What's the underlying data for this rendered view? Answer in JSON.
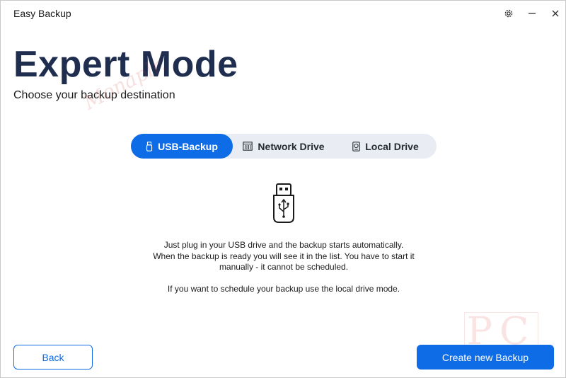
{
  "window": {
    "title": "Easy Backup",
    "controls": {
      "settings_icon": "gear-icon",
      "minimize_icon": "minimize-icon",
      "close_icon": "close-icon"
    }
  },
  "header": {
    "title": "Expert Mode",
    "subtitle": "Choose your backup destination"
  },
  "watermarks": {
    "signature": "Monaplr.",
    "corner": "PC"
  },
  "tabs": [
    {
      "label": "USB-Backup",
      "icon": "usb-icon",
      "selected": true
    },
    {
      "label": "Network Drive",
      "icon": "network-drive-icon",
      "selected": false
    },
    {
      "label": "Local Drive",
      "icon": "local-drive-icon",
      "selected": false
    }
  ],
  "usb_panel": {
    "illustration_icon": "usb-stick-icon",
    "description_lines": [
      "Just plug in your USB drive and the backup starts automatically.",
      "When the backup is ready you will see it in the list. You have to start it",
      "manually - it cannot be scheduled."
    ],
    "note": "If you want to schedule your backup use the local drive mode."
  },
  "footer": {
    "back_label": "Back",
    "create_label": "Create new Backup"
  },
  "colors": {
    "accent": "#0d6ce6",
    "title": "#1f2d4f",
    "tab_track": "#e9edf3"
  }
}
